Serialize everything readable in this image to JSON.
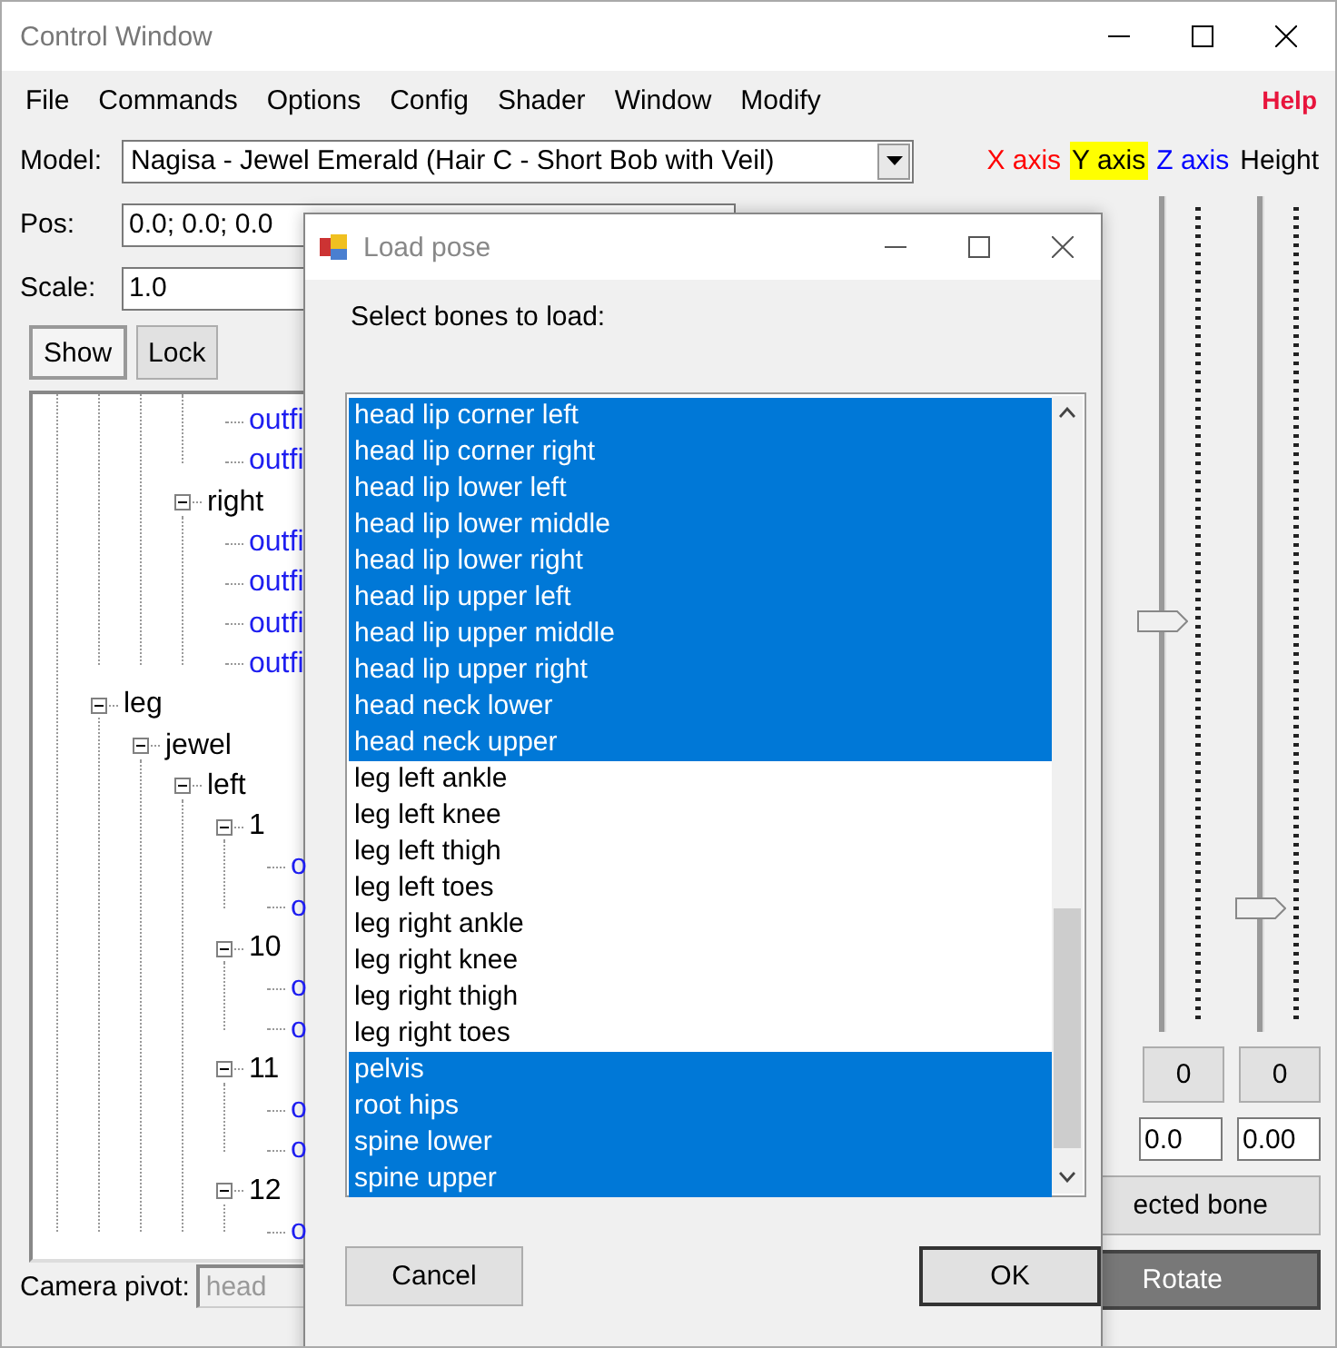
{
  "window": {
    "title": "Control Window"
  },
  "menu": [
    {
      "label": "File",
      "emphasis": false
    },
    {
      "label": "Commands",
      "emphasis": false
    },
    {
      "label": "Options",
      "emphasis": false
    },
    {
      "label": "Config",
      "emphasis": false
    },
    {
      "label": "Shader",
      "emphasis": false
    },
    {
      "label": "Window",
      "emphasis": false
    },
    {
      "label": "Modify",
      "emphasis": false
    },
    {
      "label": "Help",
      "emphasis": true
    }
  ],
  "model": {
    "label": "Model:",
    "value": "Nagisa - Jewel Emerald (Hair C - Short Bob with Veil)"
  },
  "pos": {
    "label": "Pos:",
    "value": "0.0; 0.0; 0.0"
  },
  "scale": {
    "label": "Scale:",
    "value": "1.0"
  },
  "toggles": [
    {
      "label": "Show",
      "selected": true
    },
    {
      "label": "Lock",
      "selected": false
    }
  ],
  "tree": {
    "items": [
      {
        "children": [
          {
            "children": [
              {
                "children": [
                  {
                    "label": "outfi"
                  },
                  {
                    "label": "outfi"
                  }
                ]
              },
              {
                "label": "right",
                "expanded": true,
                "children": [
                  {
                    "label": "outfi"
                  },
                  {
                    "label": "outfi"
                  },
                  {
                    "label": "outfi"
                  },
                  {
                    "label": "outfi"
                  }
                ]
              }
            ]
          }
        ]
      },
      {
        "label": "leg",
        "expanded": true,
        "children": [
          {
            "label": "jewel",
            "expanded": true,
            "children": [
              {
                "label": "left",
                "expanded": true,
                "children": [
                  {
                    "label": "1",
                    "expanded": true,
                    "children": [
                      {
                        "label": "o"
                      },
                      {
                        "label": "o"
                      }
                    ]
                  },
                  {
                    "label": "10",
                    "expanded": true,
                    "children": [
                      {
                        "label": "o"
                      },
                      {
                        "label": "o"
                      }
                    ]
                  },
                  {
                    "label": "11",
                    "expanded": true,
                    "children": [
                      {
                        "label": "o"
                      },
                      {
                        "label": "o"
                      }
                    ]
                  },
                  {
                    "label": "12",
                    "expanded": true,
                    "children": [
                      {
                        "label": "o"
                      }
                    ]
                  }
                ]
              }
            ]
          }
        ]
      }
    ]
  },
  "camera_pivot": {
    "label": "Camera pivot:",
    "value": "head",
    "disabled": true
  },
  "axes": [
    {
      "label": "X axis",
      "color": "#ff0000",
      "selected": false
    },
    {
      "label": "Y axis",
      "color": "#000000",
      "selected": true
    },
    {
      "label": "Z axis",
      "color": "#0000ff",
      "selected": false
    },
    {
      "label": "Height",
      "color": "#000000",
      "selected": false
    }
  ],
  "sliders": [
    {
      "level": 0.5
    },
    {
      "level": 0.14
    }
  ],
  "reset_buttons": [
    "0",
    "0"
  ],
  "value_fields": [
    "0.0",
    "0.00"
  ],
  "bone_button": {
    "label": "ected bone"
  },
  "rotate_button": {
    "label": "Rotate",
    "selected": true
  },
  "dialog": {
    "title": "Load pose",
    "prompt": "Select bones to load:",
    "bones": [
      {
        "label": "head lip corner left",
        "selected": true
      },
      {
        "label": "head lip corner right",
        "selected": true
      },
      {
        "label": "head lip lower left",
        "selected": true
      },
      {
        "label": "head lip lower middle",
        "selected": true
      },
      {
        "label": "head lip lower right",
        "selected": true
      },
      {
        "label": "head lip upper left",
        "selected": true
      },
      {
        "label": "head lip upper middle",
        "selected": true
      },
      {
        "label": "head lip upper right",
        "selected": true
      },
      {
        "label": "head neck lower",
        "selected": true
      },
      {
        "label": "head neck upper",
        "selected": true
      },
      {
        "label": "leg left ankle",
        "selected": false
      },
      {
        "label": "leg left knee",
        "selected": false
      },
      {
        "label": "leg left thigh",
        "selected": false
      },
      {
        "label": "leg left toes",
        "selected": false
      },
      {
        "label": "leg right ankle",
        "selected": false
      },
      {
        "label": "leg right knee",
        "selected": false
      },
      {
        "label": "leg right thigh",
        "selected": false
      },
      {
        "label": "leg right toes",
        "selected": false
      },
      {
        "label": "pelvis",
        "selected": true
      },
      {
        "label": "root hips",
        "selected": true
      },
      {
        "label": "spine lower",
        "selected": true
      },
      {
        "label": "spine upper",
        "selected": true
      }
    ],
    "buttons": [
      {
        "label": "Cancel",
        "default": false
      },
      {
        "label": "OK",
        "default": true
      }
    ]
  }
}
